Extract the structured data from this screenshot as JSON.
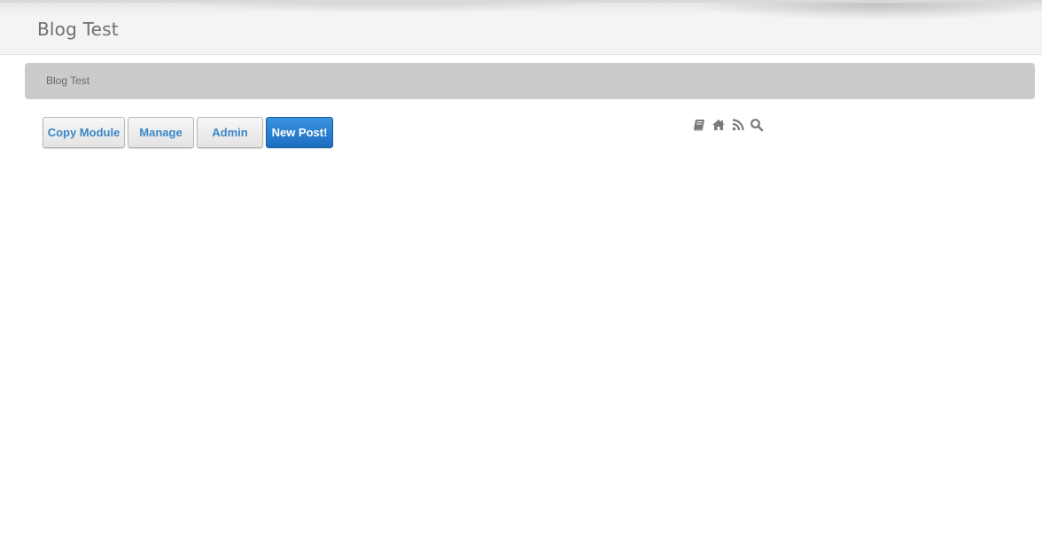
{
  "header": {
    "site_title": "Blog Test"
  },
  "breadcrumb": {
    "current": "Blog Test"
  },
  "toolbar": {
    "copy_module_label": "Copy Module",
    "manage_label": "Manage",
    "admin_label": "Admin",
    "new_post_label": "New Post!"
  },
  "icons": [
    "book-icon",
    "home-icon",
    "rss-icon",
    "search-icon"
  ],
  "colors": {
    "button_text": "#3b86c6",
    "primary_button": "#2a7fd0",
    "breadcrumb_bg": "#cbcbcb",
    "icon_gray": "#7a7a7a"
  }
}
